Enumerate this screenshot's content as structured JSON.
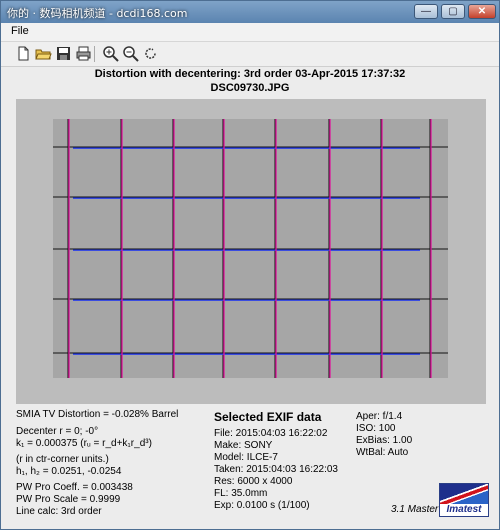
{
  "window": {
    "title": "你的 · 数码相机频道 - dcdi168.com",
    "minimize_glyph": "—",
    "maximize_glyph": "▢",
    "close_glyph": "✕"
  },
  "menu": {
    "file": "File"
  },
  "toolbar": {
    "icons": [
      "new-file-icon",
      "open-folder-icon",
      "save-icon",
      "print-icon",
      "zoom-in-icon",
      "zoom-out-icon",
      "refresh-icon"
    ]
  },
  "plot": {
    "title": "Distortion with decentering:  3rd order       03-Apr-2015 17:37:32",
    "filename": "DSC09730.JPG"
  },
  "chart_data": {
    "type": "distortion grid",
    "vertical_line_color": "#e0179d",
    "horizontal_line_color": "#2b3fe8",
    "grid_color": "#111111",
    "vertical_lines": 8,
    "horizontal_lines": 5
  },
  "results": {
    "smia": "SMIA TV Distortion = -0.028% Barrel",
    "decenter": "Decenter r = 0;  -0°",
    "k1": "k₁ = 0.000375  (rᵤ = r_d+k₁r_d³)",
    "units": "(r in ctr-corner units.)",
    "h": "h₁, h₂ = 0.0251, -0.0254",
    "pw_coeff": "PW Pro Coeff. = 0.003438",
    "pw_scale": "PW Pro Scale = 0.9999",
    "line_calc": "Line calc: 3rd order"
  },
  "exif": {
    "heading": "Selected EXIF data",
    "file": "File:  2015:04:03 16:22:02",
    "make": "Make:  SONY",
    "model": "Model: ILCE-7",
    "taken": "Taken: 2015:04:03 16:22:03",
    "res": "Res:    6000 x 4000",
    "fl": "FL:  35.0mm",
    "exp": "Exp:   0.0100 s  (1/100)"
  },
  "exif_right": {
    "aper": "Aper:  f/1.4",
    "iso": "ISO:    100",
    "exbias": "ExBias:  1.00",
    "wtbal": "WtBal:  Auto"
  },
  "version": "3.1  Master",
  "logo_text": "Imatest"
}
